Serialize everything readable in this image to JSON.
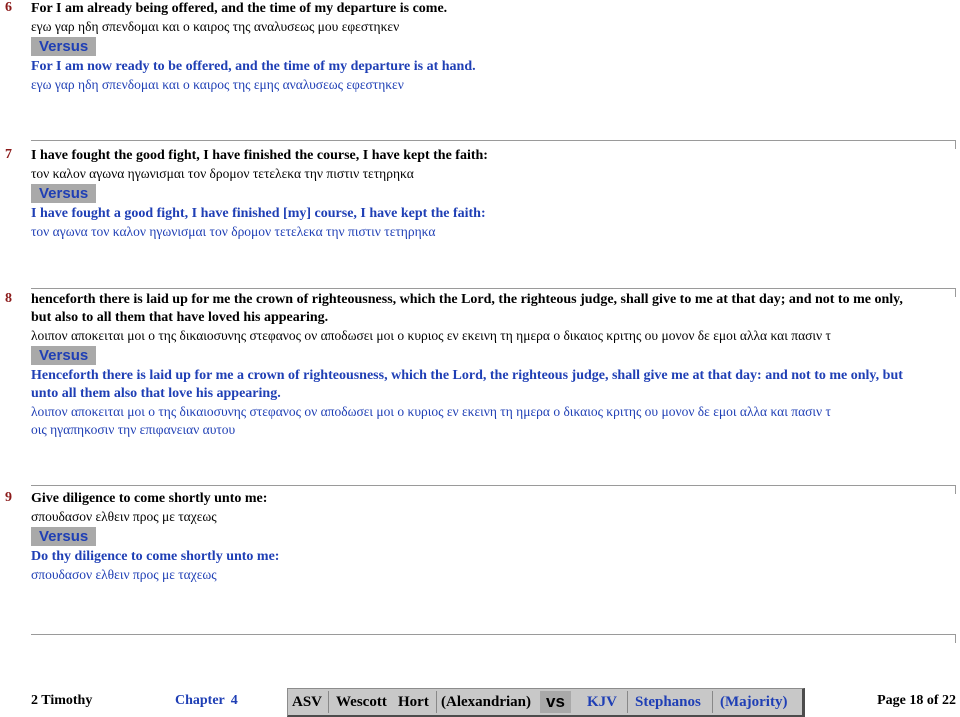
{
  "versus_label": "Versus",
  "verses": [
    {
      "num": "6",
      "kjv": [
        "For I am already being offered, and the time of my departure is come."
      ],
      "greek_wh": [
        "εγω γαρ ηδη σπενδομαι και ο καιρος της αναλυσεως μου εφεστηκεν"
      ],
      "kjv2": [
        "For I am now ready to be offered, and the time of my departure is at hand."
      ],
      "greek_st": [
        "εγω γαρ ηδη σπενδομαι και ο καιρος της εμης αναλυσεως εφεστηκεν"
      ]
    },
    {
      "num": "7",
      "kjv": [
        "I have fought the good fight, I have finished the course, I have kept the faith:"
      ],
      "greek_wh": [
        "τον καλον αγωνα ηγωνισμαι τον δρομον τετελεκα την πιστιν τετηρηκα"
      ],
      "kjv2": [
        "I have fought a good fight, I have finished [my] course, I have kept the faith:"
      ],
      "greek_st": [
        "τον αγωνα τον καλον ηγωνισμαι τον δρομον τετελεκα την πιστιν τετηρηκα"
      ]
    },
    {
      "num": "8",
      "kjv": [
        "henceforth there is laid up for me the crown of righteousness, which the Lord, the righteous judge, shall give to me at that day; and not to me only,",
        "but also to all them that have loved his appearing."
      ],
      "greek_wh": [
        "λοιπον αποκειται μοι ο της δικαιοσυνης στεφανος ον αποδωσει μοι ο κυριος εν εκεινη τη ημερα ο δικαιος κριτης ου μονον δε εμοι αλλα και πασιν τ"
      ],
      "kjv2": [
        "Henceforth there is laid up for me a crown of righteousness, which the Lord, the righteous judge, shall give me at that day: and not to me only, but",
        "unto all them also that love his appearing."
      ],
      "greek_st": [
        "λοιπον αποκειται μοι ο της δικαιοσυνης στεφανος ον αποδωσει μοι ο κυριος εν εκεινη τη ημερα ο δικαιος κριτης ου μονον δε εμοι αλλα και πασιν τ",
        "οις ηγαπηκοσιν την επιφανειαν αυτου"
      ]
    },
    {
      "num": "9",
      "kjv": [
        "Give diligence to come shortly unto me:"
      ],
      "greek_wh": [
        "σπουδασον ελθειν προς με ταχεως"
      ],
      "kjv2": [
        "Do thy diligence to come shortly unto me:"
      ],
      "greek_st": [
        "σπουδασον ελθειν προς με ταχεως"
      ]
    }
  ],
  "footer": {
    "book": "2 Timothy",
    "chapter_label": "Chapter",
    "chapter_num": "4",
    "left_versions": [
      "ASV",
      "Wescott",
      "Hort",
      "(Alexandrian)"
    ],
    "vs_label": "vs",
    "right_versions": [
      "KJV",
      "Stephanos",
      "(Majority)"
    ],
    "page": "Page 18 of 22"
  }
}
